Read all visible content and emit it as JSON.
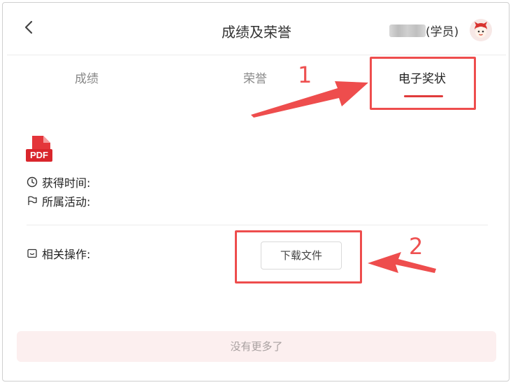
{
  "header": {
    "back_icon": "chevron-left-icon",
    "back_glyph": "‹",
    "title": "成绩及荣誉",
    "user_role": "(学员)",
    "avatar_icon": "cartoon-avatar-icon"
  },
  "tabs": [
    {
      "label": "成绩"
    },
    {
      "label": "荣誉"
    },
    {
      "label": "电子奖状",
      "active": true
    }
  ],
  "annotations": {
    "step1": "1",
    "step2": "2",
    "color": "#ee4d4d"
  },
  "file": {
    "type_badge": "PDF",
    "obtained_time_label": "获得时间:",
    "activity_label": "所属活动:",
    "operations_label": "相关操作:",
    "download_label": "下载文件"
  },
  "footer": {
    "no_more_text": "没有更多了"
  },
  "colors": {
    "accent": "#e03b3b",
    "pdf_red": "#d9262c",
    "footer_bg": "#fcefef"
  }
}
